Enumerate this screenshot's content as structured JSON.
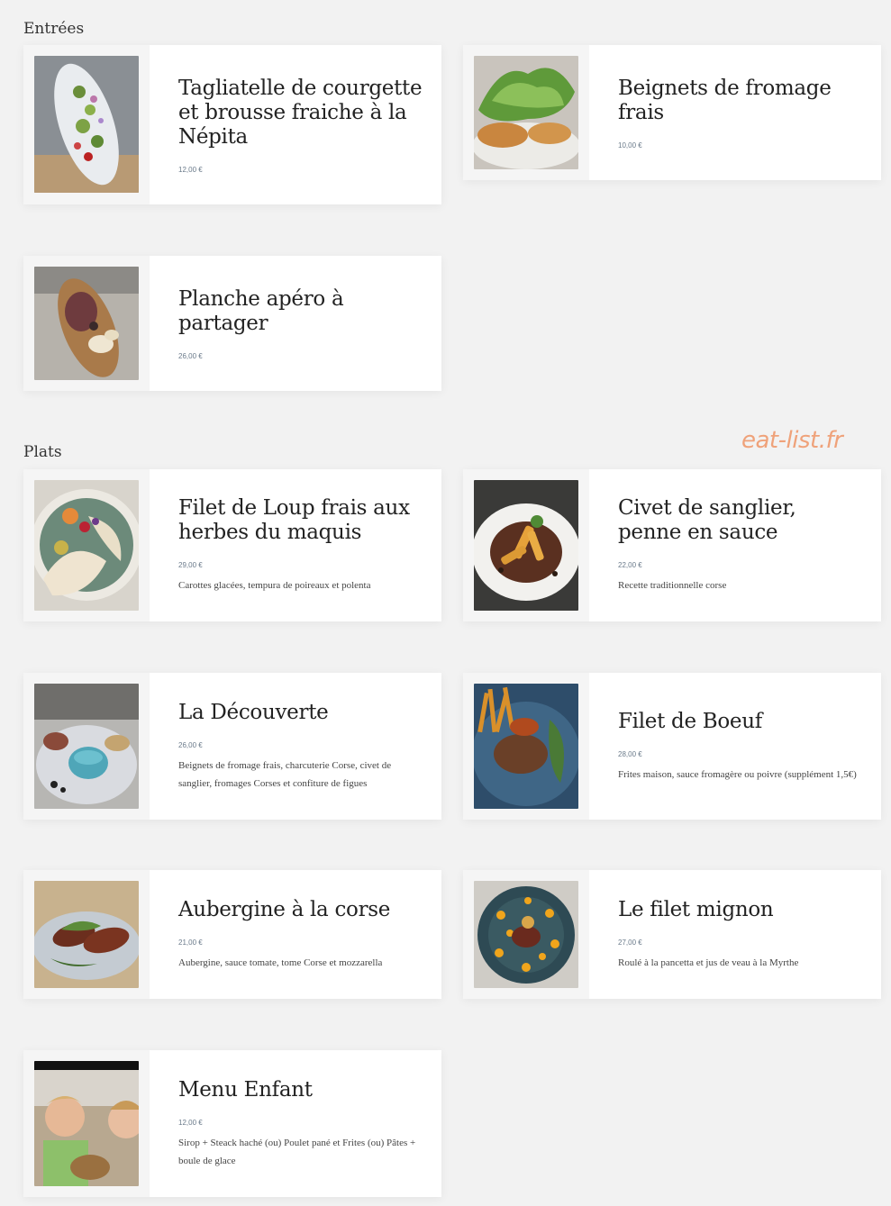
{
  "sections": {
    "entrees": {
      "title": "Entrées"
    },
    "plats": {
      "title": "Plats"
    }
  },
  "watermark": "eat-list.fr",
  "dishes": [
    {
      "name": "Tagliatelle de courgette et brousse fraiche à la Népita",
      "price": "12,00 €",
      "description": "",
      "photo": "zucchini-plate-photo"
    },
    {
      "name": "Beignets de fromage frais",
      "price": "10,00 €",
      "description": "",
      "photo": "cheese-fritters-salad-photo"
    },
    {
      "name": "Planche apéro à partager",
      "price": "26,00 €",
      "description": "",
      "photo": "charcuterie-board-photo"
    },
    {
      "name": "Filet de Loup frais aux herbes du maquis",
      "price": "29,00 €",
      "description": "Carottes glacées, tempura de poireaux et polenta",
      "photo": "sea-bass-plate-photo"
    },
    {
      "name": "Civet de sanglier, penne en sauce",
      "price": "22,00 €",
      "description": "Recette traditionnelle corse",
      "photo": "boar-stew-penne-photo"
    },
    {
      "name": "La Découverte",
      "price": "26,00 €",
      "description": "Beignets de fromage frais, charcuterie Corse, civet de sanglier, fromages Corses et confiture de figues",
      "photo": "discovery-platter-photo"
    },
    {
      "name": "Filet de Boeuf",
      "price": "28,00 €",
      "description": "Frites maison, sauce fromagère ou poivre (supplément 1,5€)",
      "photo": "beef-fillet-fries-photo"
    },
    {
      "name": "Aubergine à la corse",
      "price": "21,00 €",
      "description": "Aubergine, sauce tomate, tome Corse et mozzarella",
      "photo": "aubergine-plate-photo"
    },
    {
      "name": "Le filet mignon",
      "price": "27,00 €",
      "description": "Roulé à la pancetta et jus de veau à la Myrthe",
      "photo": "filet-mignon-photo"
    },
    {
      "name": "Menu Enfant",
      "price": "12,00 €",
      "description": "Sirop + Steack haché (ou) Poulet pané et Frites (ou) Pâtes + boule de glace",
      "photo": "children-at-table-photo"
    }
  ]
}
